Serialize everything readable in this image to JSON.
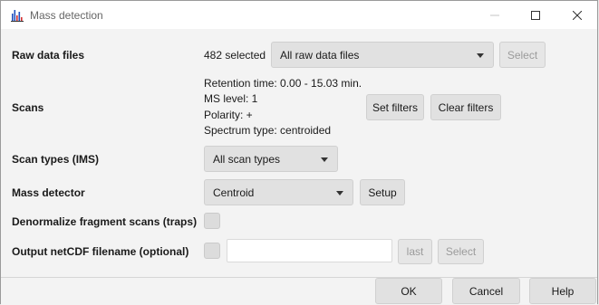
{
  "window": {
    "title": "Mass detection",
    "controls": {
      "minimize": "minimize-icon",
      "maximize": "maximize-icon",
      "close": "close-icon"
    }
  },
  "raw_data_files": {
    "label": "Raw data files",
    "count_text": "482 selected",
    "selector_value": "All raw data files",
    "select_button": "Select"
  },
  "scans": {
    "label": "Scans",
    "lines": [
      "Retention time: 0.00 - 15.03 min.",
      "MS level: 1",
      "Polarity: +",
      "Spectrum type: centroided"
    ],
    "set_filters_button": "Set filters",
    "clear_filters_button": "Clear filters"
  },
  "scan_types": {
    "label": "Scan types (IMS)",
    "value": "All scan types"
  },
  "mass_detector": {
    "label": "Mass detector",
    "value": "Centroid",
    "setup_button": "Setup"
  },
  "denormalize": {
    "label": "Denormalize fragment scans (traps)"
  },
  "output_netcdf": {
    "label": "Output netCDF filename (optional)",
    "filename_value": "",
    "last_button": "last",
    "select_button": "Select"
  },
  "footer": {
    "ok": "OK",
    "cancel": "Cancel",
    "help": "Help"
  },
  "colors": {
    "window_bg": "#f3f3f3",
    "button_bg": "#e1e1e1",
    "disabled_text": "#9b9b9b",
    "app_icon_blue": "#1f4fbf",
    "app_icon_red": "#d43030"
  }
}
